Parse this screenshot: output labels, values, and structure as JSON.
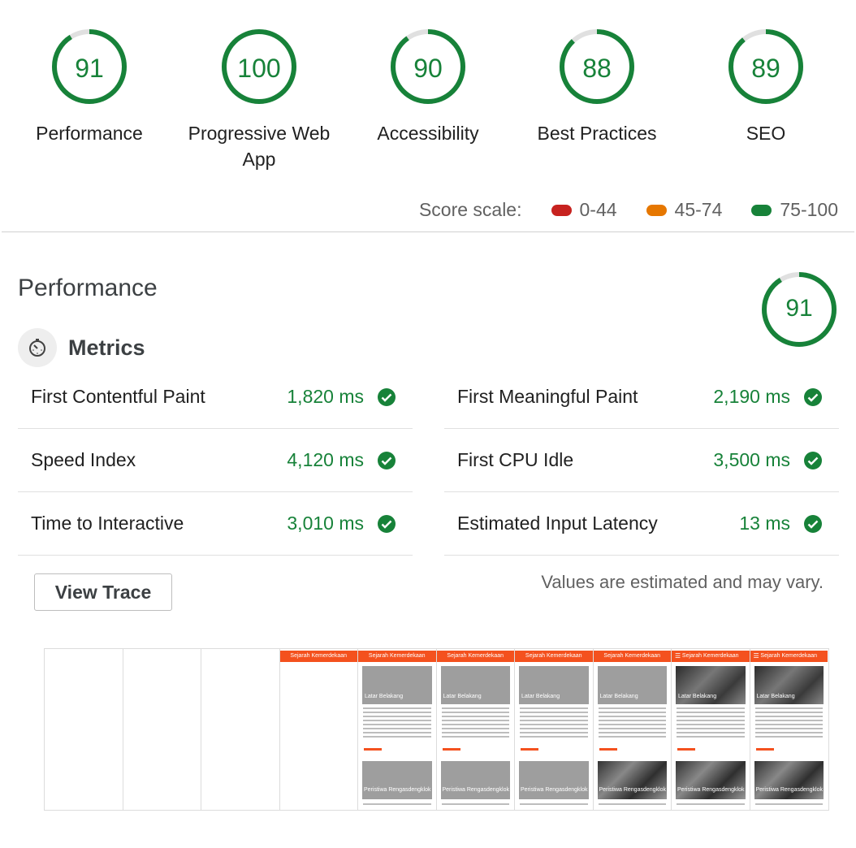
{
  "gauges": [
    {
      "score": "91",
      "label": "Performance",
      "value": 0.91
    },
    {
      "score": "100",
      "label": "Progressive Web App",
      "value": 1.0
    },
    {
      "score": "90",
      "label": "Accessibility",
      "value": 0.9
    },
    {
      "score": "88",
      "label": "Best Practices",
      "value": 0.88
    },
    {
      "score": "89",
      "label": "SEO",
      "value": 0.89
    }
  ],
  "scale": {
    "label": "Score scale:",
    "ranges": [
      {
        "text": "0-44",
        "color": "#c7221f"
      },
      {
        "text": "45-74",
        "color": "#e67700"
      },
      {
        "text": "75-100",
        "color": "#178239"
      }
    ]
  },
  "section": {
    "title": "Performance",
    "score": "91",
    "value": 0.91,
    "metrics_title": "Metrics",
    "metrics_icon": "stopwatch-icon"
  },
  "metrics": {
    "left": [
      {
        "label": "First Contentful Paint",
        "value": "1,820 ms"
      },
      {
        "label": "Speed Index",
        "value": "4,120 ms"
      },
      {
        "label": "Time to Interactive",
        "value": "3,010 ms"
      }
    ],
    "right": [
      {
        "label": "First Meaningful Paint",
        "value": "2,190 ms"
      },
      {
        "label": "First CPU Idle",
        "value": "3,500 ms"
      },
      {
        "label": "Estimated Input Latency",
        "value": "13 ms"
      }
    ]
  },
  "view_trace_label": "View Trace",
  "estimate_note": "Values are estimated and may vary.",
  "filmstrip": {
    "header_text": "Sejarah Kemerdekaan",
    "card1_title": "Latar Belakang",
    "card2_title": "Peristiwa Rengasdengklok",
    "link_text": "LEBIH LANJUT"
  },
  "colors": {
    "pass": "#178239",
    "track": "#e0e0e0",
    "accent": "#f4511e"
  }
}
